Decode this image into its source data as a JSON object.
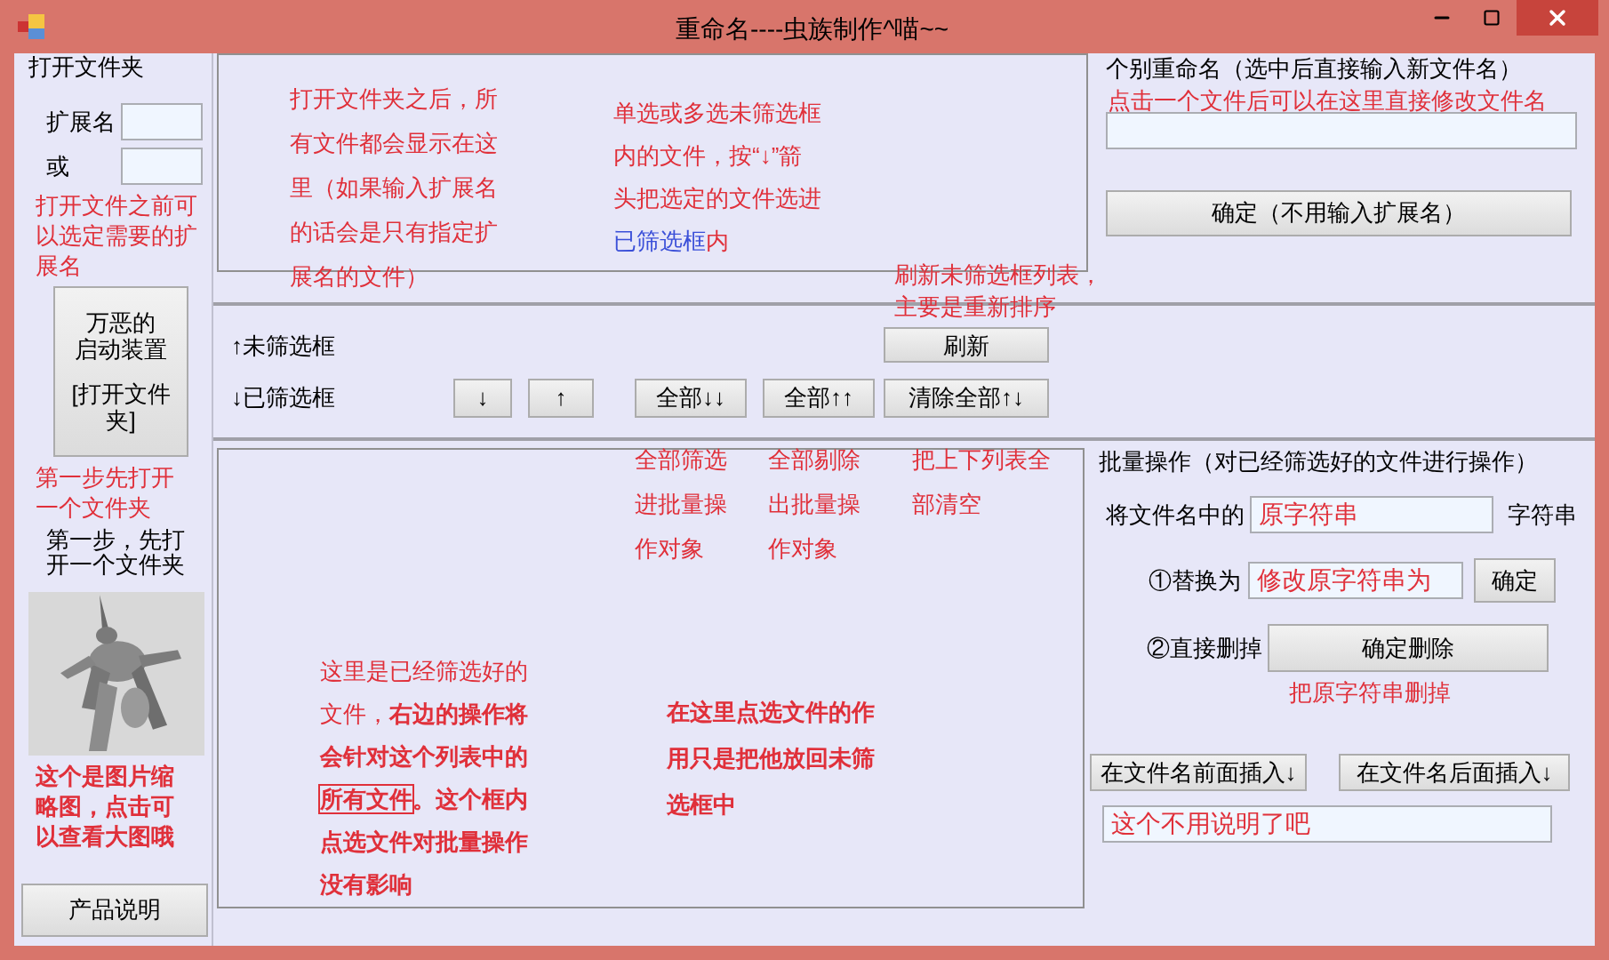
{
  "window": {
    "title": "重命名----虫族制作^喵~~"
  },
  "open_folder": {
    "title": "打开文件夹",
    "extension_label": "扩展名",
    "or_label": "或",
    "open_button": [
      "万恶的",
      "启动装置",
      "[打开文件",
      "夹]"
    ],
    "step_hint": "第一步，先打开一个文件夹",
    "about_button": "产品说明",
    "notes": [
      {
        "parts": [
          {
            "text": "打开文件之前可以选定需要的扩展名",
            "kind": "plain"
          }
        ]
      },
      {
        "parts": [
          {
            "text": "第一步先打开一个文件夹",
            "kind": "plain"
          }
        ]
      },
      {
        "parts": [
          {
            "text": "这个是图片缩略图，点击可以查看大图哦",
            "kind": "bold"
          }
        ]
      }
    ]
  },
  "single_rename": {
    "title": "个别重命名（选中后直接输入新文件名）",
    "confirm_button": "确定（不用输入扩展名）"
  },
  "filter_bar": {
    "unfiltered_label": "↑未筛选框",
    "filtered_label": "↓已筛选框",
    "refresh_button": "刷新",
    "move_buttons": [
      "↓",
      "↑",
      "全部↓↓",
      "全部↑↑",
      "清除全部↑↓"
    ]
  },
  "batch": {
    "title": "批量操作（对已经筛选好的文件进行操作）",
    "find_label": "将文件名中的",
    "find_value": "原字符串",
    "find_suffix": "字符串",
    "replace_label": "①替换为",
    "replace_value": "修改原字符串为",
    "replace_button": "确定",
    "delete_label": "②直接删掉",
    "delete_button": "确定删除",
    "insert_front_button": "在文件名前面插入↓",
    "insert_back_button": "在文件名后面插入↓",
    "insert_value": "这个不用说明了吧"
  },
  "annotations": [
    {
      "parts": [
        {
          "text": "打开文件夹之后，所有文件都会显示在这里（如果输入扩展名的话会是只有指定扩展名的文件）",
          "kind": "plain"
        }
      ]
    },
    {
      "parts": [
        {
          "text": "单选或多选未筛选框内的文件，按“↓”箭头把选定的文件选进",
          "kind": "plain"
        },
        {
          "text": "已筛选框",
          "kind": "blue"
        },
        {
          "text": "内",
          "kind": "plain"
        }
      ]
    },
    {
      "parts": [
        {
          "text": "点击一个文件后可以在这里直接修改文件名",
          "kind": "plain"
        }
      ]
    },
    {
      "parts": [
        {
          "text": "刷新未筛选框列表，主要是重新排序",
          "kind": "plain"
        }
      ]
    },
    {
      "parts": [
        {
          "text": "全部筛选进批量操作对象",
          "kind": "plain"
        }
      ]
    },
    {
      "parts": [
        {
          "text": "全部剔除出批量操作对象",
          "kind": "plain"
        }
      ]
    },
    {
      "parts": [
        {
          "text": "把上下列表全部清空",
          "kind": "plain"
        }
      ]
    },
    {
      "parts": [
        {
          "text": "这里是已经筛选好的文件，",
          "kind": "plain"
        },
        {
          "text": "右边的操作将会针对这个列表中的",
          "kind": "bold"
        },
        {
          "text": "所有文件",
          "kind": "boxed"
        },
        {
          "text": "。这个框内点选文件对批量操作没有影响",
          "kind": "bold"
        }
      ]
    },
    {
      "parts": [
        {
          "text": "在这里点选文件的作用只是把他放回未筛选框中",
          "kind": "bold"
        }
      ]
    },
    {
      "parts": [
        {
          "text": "把原字符串删掉",
          "kind": "plain"
        }
      ]
    }
  ]
}
